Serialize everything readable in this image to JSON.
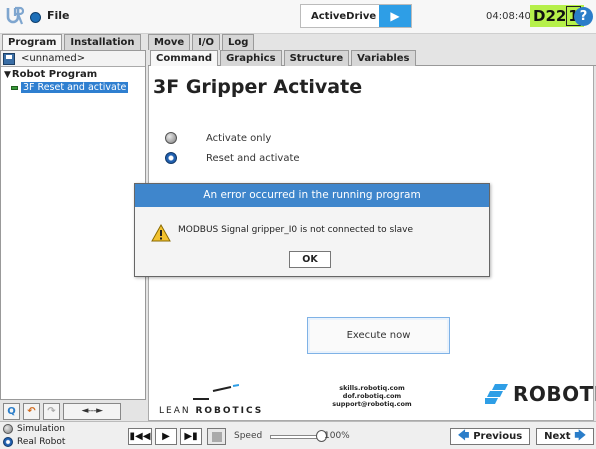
{
  "header": {
    "file_label": "File",
    "activedrive_label": "ActiveDrive",
    "clock": "04:08:40",
    "robot_id_prefix": "D22",
    "robot_id_suffix": "1",
    "help_glyph": "?"
  },
  "left": {
    "tabs": [
      {
        "label": "Program",
        "active": true
      },
      {
        "label": "Installation",
        "active": false
      }
    ],
    "program_name": "<unnamed>",
    "tree": {
      "root_label": "Robot Program",
      "child_label": "3F Reset and activate"
    },
    "toolbar": {
      "search_glyph": "Q",
      "undo_glyph": "↶",
      "redo_glyph": "↷",
      "move_glyph": "◄---►"
    }
  },
  "top_tabs": [
    {
      "label": "Move",
      "active": false
    },
    {
      "label": "I/O",
      "active": false
    },
    {
      "label": "Log",
      "active": false
    }
  ],
  "sub_tabs": [
    {
      "label": "Command",
      "active": true
    },
    {
      "label": "Graphics",
      "active": false
    },
    {
      "label": "Structure",
      "active": false
    },
    {
      "label": "Variables",
      "active": false
    }
  ],
  "content": {
    "title": "3F Gripper Activate",
    "options": [
      {
        "label": "Activate only",
        "selected": false
      },
      {
        "label": "Reset and activate",
        "selected": true
      }
    ],
    "execute_label": "Execute now",
    "lean_text_a": "LEAN ",
    "lean_text_b": "ROBOTICS",
    "urls": [
      "skills.robotiq.com",
      "dof.robotiq.com",
      "support@robotiq.com"
    ],
    "brand": "ROBOTIQ"
  },
  "dialog": {
    "title": "An error occurred in the running program",
    "message": "MODBUS Signal gripper_I0 is not connected to slave",
    "ok_label": "OK"
  },
  "bottom": {
    "mode_simulation": "Simulation",
    "mode_real": "Real Robot",
    "speed_label": "Speed",
    "speed_value": "100%",
    "speed_fraction": 1.0,
    "previous_label": "Previous",
    "next_label": "Next"
  },
  "colors": {
    "accent_blue": "#3f86cc",
    "robot_id_bg": "#b6f04a",
    "selection_blue": "#2f7fd0"
  }
}
